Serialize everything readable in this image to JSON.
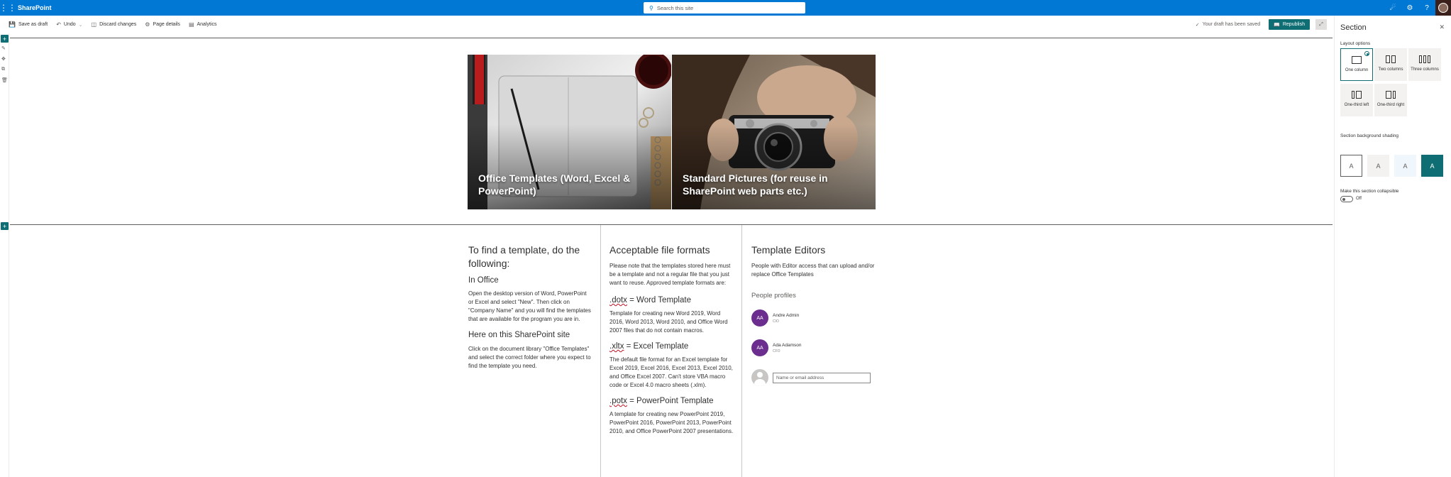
{
  "suitebar": {
    "app_name": "SharePoint",
    "search_placeholder": "Search this site"
  },
  "command_bar": {
    "save_as_draft": "Save as draft",
    "undo": "Undo",
    "discard_changes": "Discard changes",
    "page_details": "Page details",
    "analytics": "Analytics",
    "draft_status": "Your draft has been saved",
    "republish": "Republish"
  },
  "hero": {
    "tiles": [
      {
        "title": "Office Templates (Word, Excel & PowerPoint)"
      },
      {
        "title": "Standard Pictures (for reuse in SharePoint web parts etc.)"
      }
    ]
  },
  "column1": {
    "heading": "To find a template, do the following:",
    "sub1": "In Office",
    "text1": "Open the desktop version of Word, PowerPoint or Excel and select \"New\". Then click on \"Company Name\" and you will find the templates that are available for the program you are in.",
    "sub2": "Here on this SharePoint site",
    "text2": "Click on the document library \"Office Templates\" and select the correct folder where you expect to find the template you need."
  },
  "column2": {
    "heading": "Acceptable file formats",
    "intro": "Please note that the templates stored here must be a template and not a regular file that you just want to reuse. Approved template formats are:",
    "formats": [
      {
        "ext": ".dotx",
        "name": " = Word Template",
        "desc": "Template for creating new Word 2019, Word 2016, Word 2013, Word 2010, and Office Word 2007 files that do not contain macros."
      },
      {
        "ext": ".xltx",
        "name": " = Excel Template",
        "desc": "The default file format for an Excel template for Excel 2019, Excel 2016, Excel 2013, Excel 2010, and Office Excel 2007. Can't store VBA macro code or Excel 4.0 macro sheets (.xlm)."
      },
      {
        "ext": ".potx",
        "name": " = PowerPoint Template",
        "desc": "A template for creating new PowerPoint 2019, PowerPoint 2016, PowerPoint 2013, PowerPoint 2010, and Office PowerPoint 2007 presentations."
      }
    ]
  },
  "column3": {
    "heading": "Template Editors",
    "text": "People with Editor access that can upload and/or replace Office Templates",
    "profiles_title": "People profiles",
    "people": [
      {
        "initials": "AA",
        "name": "Andre Admin",
        "title": "CIO"
      },
      {
        "initials": "AA",
        "name": "Ada Adamson",
        "title": "CFO"
      }
    ],
    "add_placeholder": "Name or email address"
  },
  "pane": {
    "title": "Section",
    "layout_label": "Layout options",
    "layouts": [
      {
        "label": "One column"
      },
      {
        "label": "Two columns"
      },
      {
        "label": "Three columns"
      },
      {
        "label": "One-third left"
      },
      {
        "label": "One-third right"
      }
    ],
    "shading_label": "Section background shading",
    "shading_glyph": "A",
    "collapsible_label": "Make this section collapsible",
    "toggle_state": "Off"
  },
  "colors": {
    "brand_blue": "#0078d4",
    "accent_teal": "#0f6e74",
    "persona_purple": "#6b2d8e"
  }
}
